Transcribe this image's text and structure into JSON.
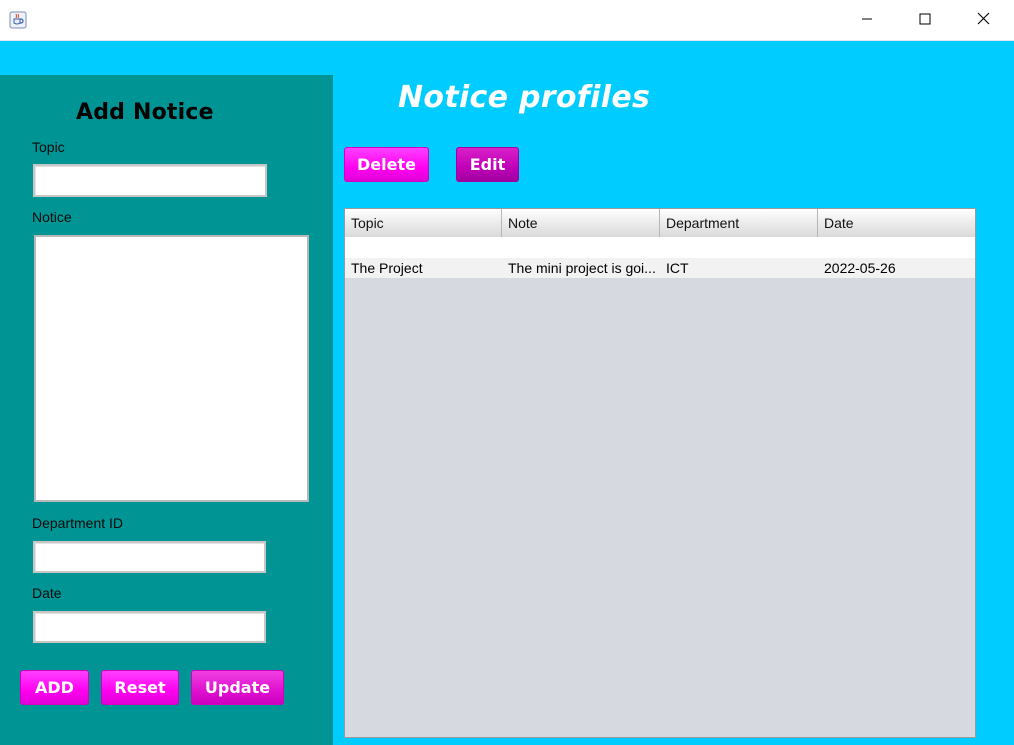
{
  "window": {
    "icon": "java-coffee-icon",
    "controls": [
      "minimize-icon",
      "maximize-icon",
      "close-icon"
    ]
  },
  "add_panel": {
    "title": "Add Notice",
    "topic_label": "Topic",
    "topic_value": "",
    "notice_label": "Notice",
    "notice_value": "",
    "department_label": "Department ID",
    "department_value": "",
    "date_label": "Date",
    "date_value": "",
    "buttons": {
      "add": "ADD",
      "reset": "Reset",
      "update": "Update"
    }
  },
  "profiles": {
    "title": "Notice profiles",
    "delete_label": "Delete",
    "edit_label": "Edit",
    "table": {
      "headers": [
        "Topic",
        "Note",
        "Department",
        "Date"
      ],
      "rows": [
        [
          "The Project",
          "The mini project is goi...",
          "ICT",
          "2022-05-26"
        ]
      ]
    }
  },
  "colors": {
    "background": "#00ccff",
    "left_panel": "#009494",
    "button_pink": "#ff00f0",
    "button_purple": "#c000b8",
    "table_bg": "#d6d9e0"
  }
}
